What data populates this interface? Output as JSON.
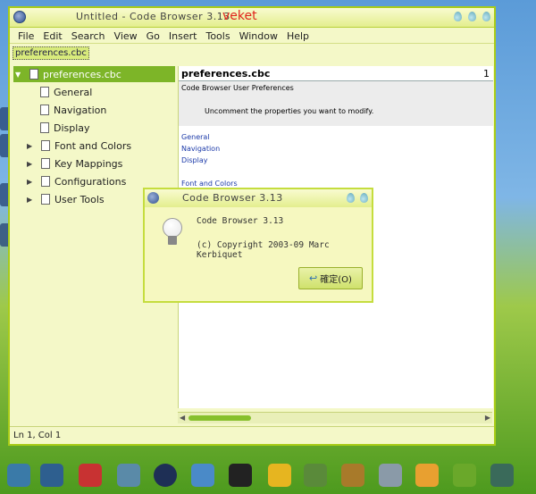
{
  "window": {
    "title": "Untitled - Code Browser 3.13",
    "brand": "veket"
  },
  "menu": [
    "File",
    "Edit",
    "Search",
    "View",
    "Go",
    "Insert",
    "Tools",
    "Window",
    "Help"
  ],
  "toolbar": {
    "open_tab": "preferences.cbc"
  },
  "tree": {
    "root": "preferences.cbc",
    "items": [
      {
        "label": "General",
        "expandable": false
      },
      {
        "label": "Navigation",
        "expandable": false
      },
      {
        "label": "Display",
        "expandable": false
      },
      {
        "label": "Font and Colors",
        "expandable": true
      },
      {
        "label": "Key Mappings",
        "expandable": true
      },
      {
        "label": "Configurations",
        "expandable": true
      },
      {
        "label": "User Tools",
        "expandable": true
      }
    ]
  },
  "editor": {
    "filename": "preferences.cbc",
    "line_indicator": "1",
    "heading": "Code Browser User Preferences",
    "note": "Uncomment the properties you want to modify.",
    "links": [
      "General",
      "Navigation",
      "Display"
    ],
    "section_link": "Font and Colors"
  },
  "dialog": {
    "title": "Code Browser 3.13",
    "app_name": "Code Browser 3.13",
    "copyright": "(c) Copyright 2003-09 Marc Kerbiquet",
    "ok_label": "確定(O)"
  },
  "status": {
    "position": "Ln 1, Col 1"
  },
  "colors": {
    "accent": "#a9cc17",
    "selection": "#7db528",
    "link": "#1c3aa9"
  },
  "icons": [
    "app-icon",
    "bulb-icon",
    "ok-arrow-icon",
    "document-icon"
  ]
}
